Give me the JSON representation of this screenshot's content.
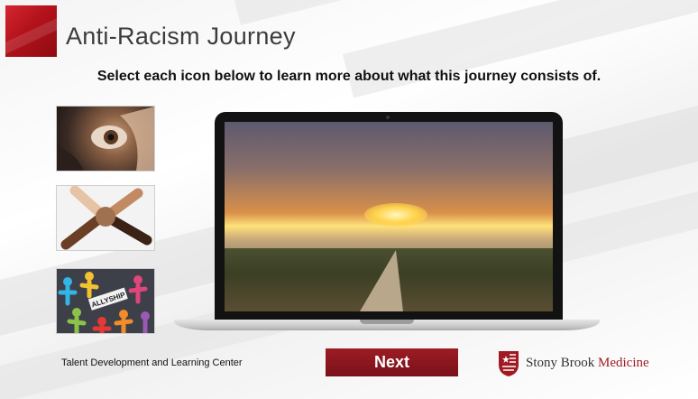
{
  "header": {
    "title": "Anti-Racism Journey",
    "instruction": "Select each icon below to learn more about what this journey consists of."
  },
  "icons": [
    {
      "name": "eye-closeup-icon"
    },
    {
      "name": "joined-hands-icon"
    },
    {
      "name": "allyship-figures-icon",
      "sign_text": "ALLYSHIP"
    }
  ],
  "footer": {
    "department": "Talent Development and Learning Center",
    "next_label": "Next",
    "logo_part1": "Stony Brook",
    "logo_part2": "Medicine"
  },
  "colors": {
    "brand_red": "#8e1219",
    "title_gray": "#3c3c3c"
  }
}
